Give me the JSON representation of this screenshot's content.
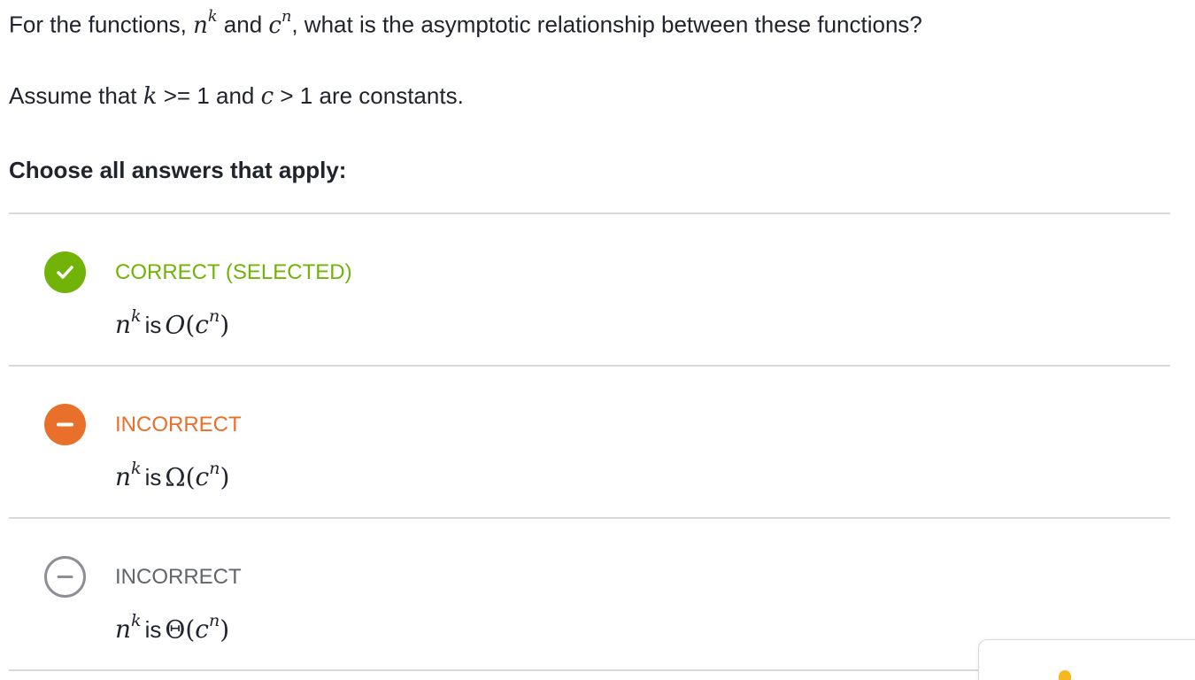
{
  "question": {
    "prefix": "For the functions, ",
    "f1_base": "n",
    "f1_exp": "k",
    "mid": " and ",
    "f2_base": "c",
    "f2_exp": "n",
    "suffix": ", what is the asymptotic relationship between these functions?"
  },
  "assumption": {
    "prefix": "Assume that ",
    "var_k": "k",
    "mid": " >= 1 and ",
    "var_c": "c",
    "suffix": " > 1 are constants."
  },
  "prompt": "Choose all answers that apply:",
  "choices": [
    {
      "status": "CORRECT (SELECTED)",
      "status_kind": "correct",
      "icon": "check-icon",
      "lhs_base": "n",
      "lhs_exp": "k",
      "word": "is",
      "notation": "O",
      "arg_base": "c",
      "arg_exp": "n"
    },
    {
      "status": "INCORRECT",
      "status_kind": "incorrect-selected",
      "icon": "minus-icon",
      "lhs_base": "n",
      "lhs_exp": "k",
      "word": "is",
      "notation": "Ω",
      "arg_base": "c",
      "arg_exp": "n"
    },
    {
      "status": "INCORRECT",
      "status_kind": "incorrect",
      "icon": "minus-outline-icon",
      "lhs_base": "n",
      "lhs_exp": "k",
      "word": "is",
      "notation": "Θ",
      "arg_base": "c",
      "arg_exp": "n"
    }
  ],
  "colors": {
    "correct": "#71b307",
    "incorrect_selected": "#e8702a",
    "incorrect": "#8d8f94",
    "divider": "#d6d8da"
  }
}
